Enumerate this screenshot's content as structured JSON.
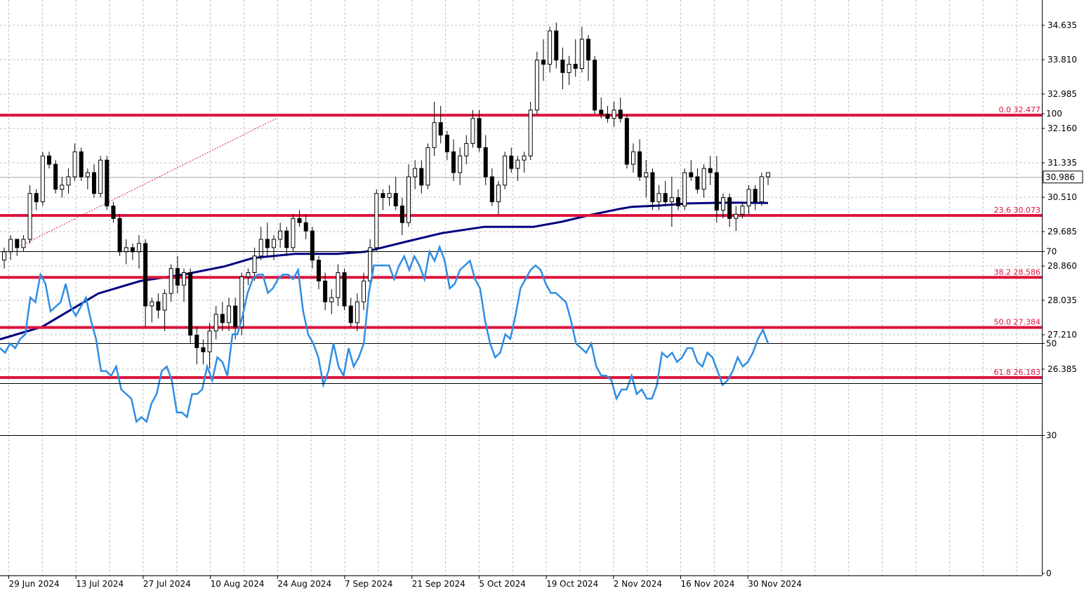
{
  "chart_data": [
    {
      "type": "candlestick",
      "y_ticks": [
        "34.635",
        "33.810",
        "32.985",
        "32.160",
        "31.335",
        "30.510",
        "29.685",
        "28.860",
        "28.035",
        "27.210",
        "26.385"
      ],
      "current_price": "30.986",
      "ylim": [
        25.95,
        35.15
      ],
      "x_ticks": [
        "29 Jun 2024",
        "13 Jul 2024",
        "27 Jul 2024",
        "10 Aug 2024",
        "24 Aug 2024",
        "7 Sep 2024",
        "21 Sep 2024",
        "5 Oct 2024",
        "19 Oct 2024",
        "2 Nov 2024",
        "16 Nov 2024",
        "30 Nov 2024"
      ],
      "fib_levels": [
        {
          "label": "0.0 32.477",
          "value": 32.477
        },
        {
          "label": "23.6 30.073",
          "value": 30.073
        },
        {
          "label": "38.2 28.586",
          "value": 28.586
        },
        {
          "label": "50.0 27.384",
          "value": 27.384
        },
        {
          "label": "61.8 26.183",
          "value": 26.183
        }
      ],
      "colors": {
        "fib": "#dc143c",
        "ma": "#000080",
        "candle": "#000000",
        "grid": "#c0c0c0"
      },
      "candles": [
        [
          29.0,
          29.3,
          28.8,
          29.2
        ],
        [
          29.2,
          29.6,
          29.0,
          29.5
        ],
        [
          29.5,
          29.4,
          29.1,
          29.3
        ],
        [
          29.3,
          29.6,
          29.2,
          29.5
        ],
        [
          29.5,
          30.8,
          29.4,
          30.6
        ],
        [
          30.6,
          30.7,
          30.2,
          30.4
        ],
        [
          30.4,
          31.6,
          30.3,
          31.5
        ],
        [
          31.5,
          31.6,
          31.2,
          31.3
        ],
        [
          31.3,
          31.4,
          30.6,
          30.7
        ],
        [
          30.7,
          31.0,
          30.5,
          30.8
        ],
        [
          30.8,
          31.2,
          30.6,
          31.0
        ],
        [
          31.0,
          31.8,
          30.9,
          31.6
        ],
        [
          31.6,
          31.7,
          30.9,
          31.0
        ],
        [
          31.0,
          31.2,
          30.7,
          31.1
        ],
        [
          31.1,
          31.3,
          30.5,
          30.6
        ],
        [
          30.6,
          31.5,
          30.5,
          31.4
        ],
        [
          31.4,
          31.5,
          30.2,
          30.3
        ],
        [
          30.3,
          30.4,
          29.9,
          30.0
        ],
        [
          30.0,
          30.1,
          29.1,
          29.2
        ],
        [
          29.2,
          29.5,
          28.9,
          29.3
        ],
        [
          29.3,
          29.4,
          29.0,
          29.2
        ],
        [
          29.2,
          29.6,
          28.8,
          29.4
        ],
        [
          29.4,
          29.5,
          27.4,
          27.9
        ],
        [
          27.9,
          28.1,
          27.5,
          28.0
        ],
        [
          28.0,
          28.2,
          27.6,
          27.8
        ],
        [
          27.8,
          28.3,
          27.3,
          28.2
        ],
        [
          28.2,
          28.9,
          28.0,
          28.8
        ],
        [
          28.8,
          29.1,
          28.2,
          28.4
        ],
        [
          28.4,
          28.8,
          28.0,
          28.7
        ],
        [
          28.7,
          28.8,
          27.0,
          27.2
        ],
        [
          27.2,
          27.4,
          26.5,
          26.9
        ],
        [
          26.9,
          27.1,
          26.5,
          26.8
        ],
        [
          26.8,
          27.5,
          26.4,
          27.3
        ],
        [
          27.3,
          27.9,
          27.1,
          27.7
        ],
        [
          27.7,
          28.0,
          27.3,
          27.5
        ],
        [
          27.5,
          28.1,
          27.3,
          27.9
        ],
        [
          27.9,
          28.1,
          27.1,
          27.4
        ],
        [
          27.4,
          28.7,
          27.2,
          28.6
        ],
        [
          28.6,
          28.8,
          28.4,
          28.7
        ],
        [
          28.7,
          29.3,
          28.5,
          29.1
        ],
        [
          29.1,
          29.8,
          29.0,
          29.5
        ],
        [
          29.5,
          29.9,
          29.1,
          29.3
        ],
        [
          29.3,
          29.6,
          29.0,
          29.5
        ],
        [
          29.5,
          29.9,
          29.3,
          29.7
        ],
        [
          29.7,
          29.8,
          29.1,
          29.3
        ],
        [
          29.3,
          30.1,
          29.2,
          30.0
        ],
        [
          30.0,
          30.2,
          29.8,
          29.9
        ],
        [
          29.9,
          30.1,
          29.5,
          29.7
        ],
        [
          29.7,
          29.8,
          28.8,
          29.0
        ],
        [
          29.0,
          29.1,
          28.3,
          28.5
        ],
        [
          28.5,
          28.7,
          27.8,
          28.0
        ],
        [
          28.0,
          28.3,
          27.7,
          28.1
        ],
        [
          28.1,
          28.9,
          27.9,
          28.7
        ],
        [
          28.7,
          28.8,
          27.8,
          27.9
        ],
        [
          27.9,
          28.1,
          27.4,
          27.5
        ],
        [
          27.5,
          28.2,
          27.3,
          28.0
        ],
        [
          28.0,
          28.7,
          27.8,
          28.5
        ],
        [
          28.5,
          29.5,
          28.3,
          29.3
        ],
        [
          29.3,
          30.7,
          29.2,
          30.6
        ],
        [
          30.6,
          30.7,
          30.2,
          30.5
        ],
        [
          30.5,
          30.8,
          30.3,
          30.6
        ],
        [
          30.6,
          31.0,
          30.2,
          30.3
        ],
        [
          30.3,
          30.5,
          29.6,
          29.9
        ],
        [
          29.9,
          31.3,
          29.8,
          31.0
        ],
        [
          31.0,
          31.4,
          30.7,
          31.2
        ],
        [
          31.2,
          31.4,
          30.6,
          30.8
        ],
        [
          30.8,
          31.8,
          30.7,
          31.7
        ],
        [
          31.7,
          32.8,
          31.5,
          32.3
        ],
        [
          32.3,
          32.7,
          31.8,
          32.0
        ],
        [
          32.0,
          32.1,
          31.4,
          31.6
        ],
        [
          31.6,
          31.9,
          30.9,
          31.1
        ],
        [
          31.1,
          31.7,
          30.8,
          31.5
        ],
        [
          31.5,
          32.0,
          31.3,
          31.8
        ],
        [
          31.8,
          32.6,
          31.7,
          32.4
        ],
        [
          32.4,
          32.6,
          31.6,
          31.7
        ],
        [
          31.7,
          32.0,
          30.8,
          31.0
        ],
        [
          31.0,
          31.2,
          30.3,
          30.4
        ],
        [
          30.4,
          30.9,
          30.1,
          30.8
        ],
        [
          30.8,
          31.6,
          30.7,
          31.5
        ],
        [
          31.5,
          31.7,
          31.1,
          31.2
        ],
        [
          31.2,
          31.5,
          30.9,
          31.4
        ],
        [
          31.4,
          31.6,
          31.1,
          31.5
        ],
        [
          31.5,
          32.8,
          31.4,
          32.6
        ],
        [
          32.6,
          34.0,
          32.5,
          33.8
        ],
        [
          33.8,
          34.3,
          33.3,
          33.7
        ],
        [
          33.7,
          34.6,
          33.5,
          34.5
        ],
        [
          34.5,
          34.7,
          33.6,
          33.8
        ],
        [
          33.8,
          34.1,
          33.1,
          33.5
        ],
        [
          33.5,
          33.9,
          33.2,
          33.7
        ],
        [
          33.7,
          34.3,
          33.4,
          33.6
        ],
        [
          33.6,
          34.6,
          33.5,
          34.3
        ],
        [
          34.3,
          34.4,
          33.3,
          33.8
        ],
        [
          33.8,
          33.9,
          32.5,
          32.6
        ],
        [
          32.6,
          32.9,
          32.4,
          32.5
        ],
        [
          32.5,
          32.7,
          32.3,
          32.4
        ],
        [
          32.4,
          32.8,
          32.2,
          32.6
        ],
        [
          32.6,
          32.9,
          32.3,
          32.4
        ],
        [
          32.4,
          32.5,
          31.2,
          31.3
        ],
        [
          31.3,
          31.8,
          31.1,
          31.6
        ],
        [
          31.6,
          31.9,
          30.9,
          31.0
        ],
        [
          31.0,
          31.4,
          30.5,
          31.1
        ],
        [
          31.1,
          31.2,
          30.2,
          30.4
        ],
        [
          30.4,
          30.8,
          30.2,
          30.6
        ],
        [
          30.6,
          30.9,
          30.3,
          30.4
        ],
        [
          30.4,
          31.0,
          29.8,
          30.5
        ],
        [
          30.5,
          30.7,
          30.2,
          30.3
        ],
        [
          30.3,
          31.2,
          30.2,
          31.1
        ],
        [
          31.1,
          31.4,
          30.9,
          31.0
        ],
        [
          31.0,
          31.2,
          30.6,
          30.7
        ],
        [
          30.7,
          31.3,
          30.5,
          31.2
        ],
        [
          31.2,
          31.5,
          30.8,
          31.1
        ],
        [
          31.1,
          31.5,
          29.9,
          30.2
        ],
        [
          30.2,
          30.6,
          30.0,
          30.5
        ],
        [
          30.5,
          30.6,
          29.8,
          30.0
        ],
        [
          30.0,
          30.3,
          29.7,
          30.1
        ],
        [
          30.1,
          30.4,
          30.0,
          30.3
        ],
        [
          30.3,
          30.8,
          30.1,
          30.7
        ],
        [
          30.7,
          30.8,
          30.2,
          30.4
        ],
        [
          30.4,
          31.1,
          30.3,
          31.0
        ],
        [
          31.0,
          31.1,
          30.8,
          31.1
        ]
      ],
      "ma": [
        [
          0,
          27.1
        ],
        [
          60,
          27.4
        ],
        [
          140,
          28.2
        ],
        [
          200,
          28.5
        ],
        [
          260,
          28.65
        ],
        [
          320,
          28.85
        ],
        [
          360,
          29.05
        ],
        [
          420,
          29.15
        ],
        [
          480,
          29.15
        ],
        [
          520,
          29.2
        ],
        [
          580,
          29.45
        ],
        [
          630,
          29.65
        ],
        [
          690,
          29.8
        ],
        [
          760,
          29.8
        ],
        [
          800,
          29.92
        ],
        [
          840,
          30.08
        ],
        [
          880,
          30.22
        ],
        [
          900,
          30.28
        ],
        [
          940,
          30.31
        ],
        [
          980,
          30.36
        ],
        [
          1040,
          30.38
        ],
        [
          1094,
          30.37
        ]
      ]
    },
    {
      "type": "line",
      "y_ticks": [
        "100",
        "70",
        "50",
        "30",
        "0"
      ],
      "levels": [
        70,
        50,
        30
      ],
      "ylim": [
        0,
        100
      ],
      "color": "#2f8de4",
      "values": [
        49,
        48,
        50,
        49,
        51,
        52,
        60,
        59,
        65,
        63,
        57,
        58,
        59,
        63,
        58,
        56,
        58,
        60,
        55,
        51,
        44,
        44,
        43,
        45,
        40,
        39,
        38,
        33,
        34,
        33,
        37,
        39,
        44,
        45,
        42,
        35,
        35,
        34,
        39,
        39,
        40,
        45,
        42,
        47,
        46,
        43,
        52,
        52,
        56,
        61,
        64,
        65,
        65,
        61,
        62,
        64,
        65,
        65,
        64,
        66,
        57,
        52,
        50,
        47,
        41,
        44,
        50,
        45,
        43,
        49,
        45,
        47,
        50,
        61,
        67,
        67,
        67,
        67,
        64,
        67,
        69,
        66,
        69,
        67,
        64,
        70,
        68,
        71,
        68,
        62,
        63,
        66,
        67,
        68,
        64,
        62,
        55,
        50,
        47,
        48,
        52,
        51,
        56,
        62,
        64,
        66,
        67,
        66,
        63,
        61,
        61,
        60,
        59,
        55,
        50,
        49,
        48,
        50,
        45,
        43,
        43,
        42,
        38,
        40,
        40,
        43,
        39,
        40,
        38,
        38,
        41,
        48,
        47,
        48,
        46,
        47,
        49,
        49,
        46,
        45,
        48,
        47,
        44,
        41,
        42,
        44,
        47,
        45,
        46,
        48,
        51,
        53,
        50
      ]
    }
  ]
}
